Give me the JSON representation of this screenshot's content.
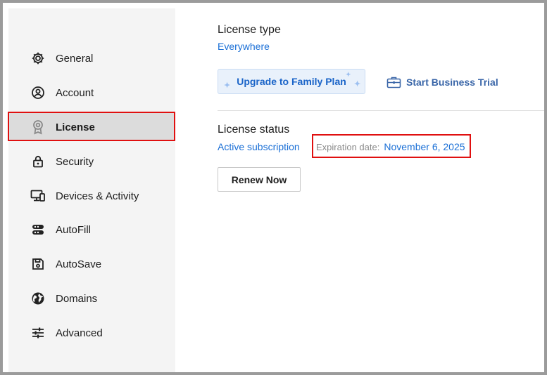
{
  "sidebar": {
    "items": [
      {
        "label": "General",
        "icon": "gear-icon"
      },
      {
        "label": "Account",
        "icon": "user-circle-icon"
      },
      {
        "label": "License",
        "icon": "badge-icon",
        "active": true
      },
      {
        "label": "Security",
        "icon": "lock-icon"
      },
      {
        "label": "Devices & Activity",
        "icon": "devices-icon"
      },
      {
        "label": "AutoFill",
        "icon": "autofill-icon"
      },
      {
        "label": "AutoSave",
        "icon": "floppy-disk-icon"
      },
      {
        "label": "Domains",
        "icon": "globe-icon"
      },
      {
        "label": "Advanced",
        "icon": "sliders-icon"
      }
    ]
  },
  "license": {
    "type_title": "License type",
    "type_value": "Everywhere",
    "upgrade_label": "Upgrade to Family Plan",
    "trial_label": "Start Business Trial",
    "status_title": "License status",
    "status_value": "Active subscription",
    "expiration_label": "Expiration date:",
    "expiration_value": "November 6, 2025",
    "renew_label": "Renew Now"
  },
  "colors": {
    "accent": "#1a6fd6",
    "highlight": "#e01010",
    "sidebar_bg": "#f4f4f4",
    "active_bg": "#dcdcdc"
  }
}
